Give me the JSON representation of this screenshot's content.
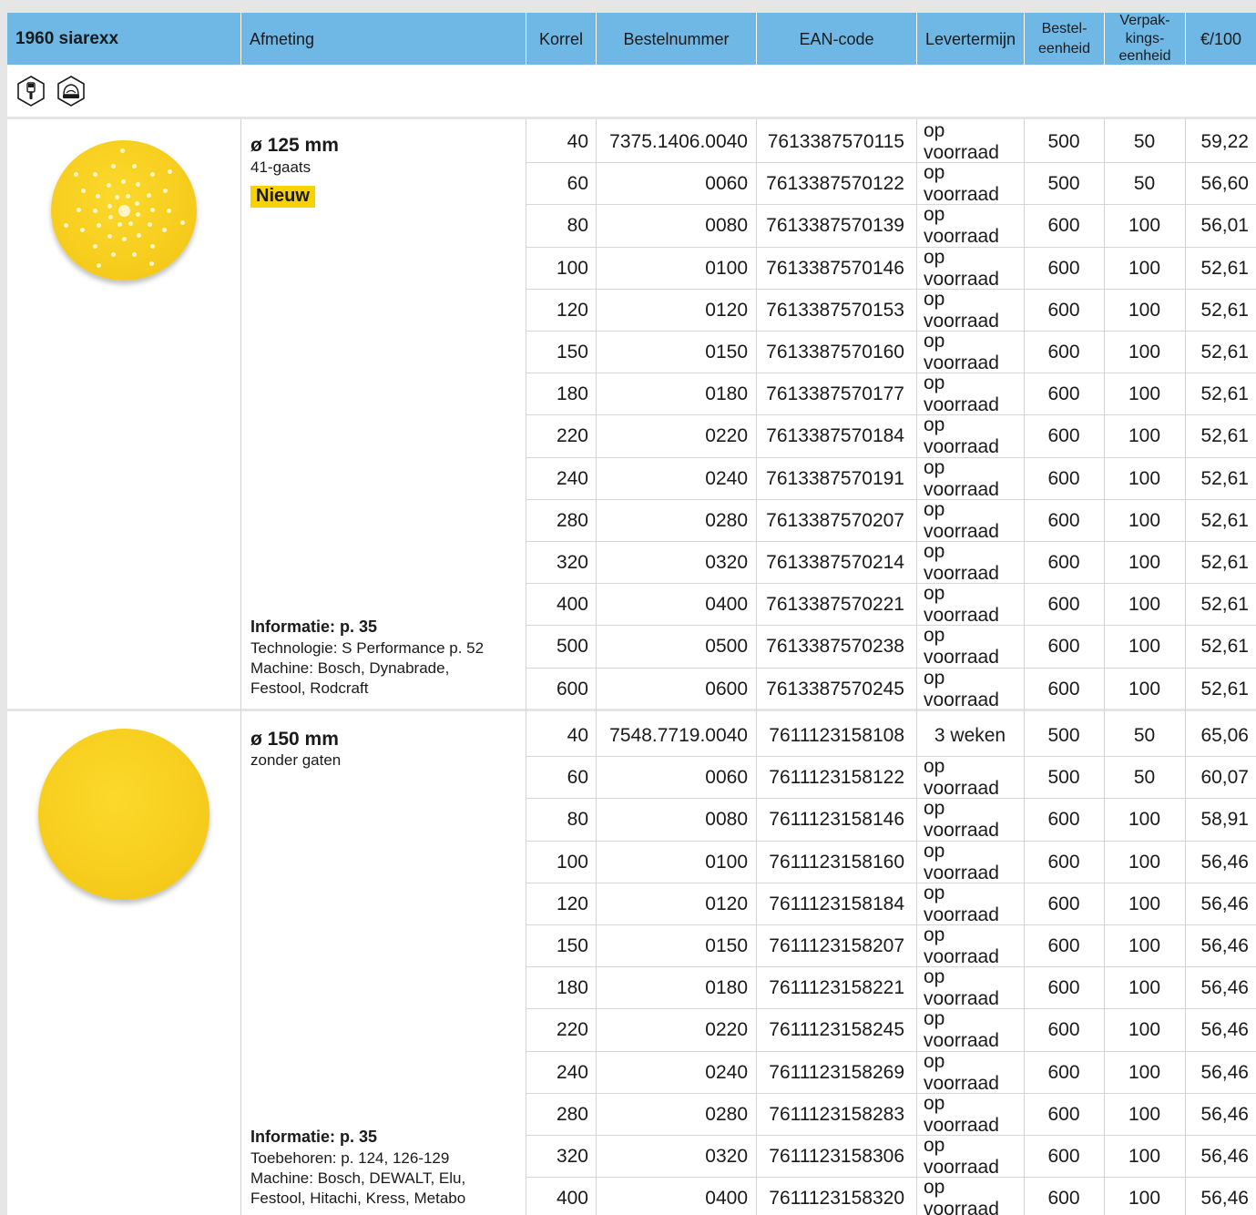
{
  "header": {
    "product": "1960 siarexx",
    "afmeting": "Afmeting",
    "korrel": "Korrel",
    "bestelnummer": "Bestelnummer",
    "ean": "EAN-code",
    "levertermijn": "Levertermijn",
    "besteleenheid_1": "Bestel-",
    "besteleenheid_2": "eenheid",
    "verpak_1": "Verpak-",
    "verpak_2": "kings-",
    "verpak_3": "eenheid",
    "price": "€/100"
  },
  "icons": [
    "brush-hex-icon",
    "sanding-machine-hex-icon"
  ],
  "sections": [
    {
      "size": "ø 125 mm",
      "subtitle": "41-gaats",
      "badge": "Nieuw",
      "info_title": "Informatie: p. 35",
      "notes": [
        "Technologie: S Performance p. 52",
        "Machine: Bosch, Dynabrade,",
        "Festool, Rodcraft"
      ],
      "rows": [
        {
          "korrel": "40",
          "bestel": "7375.1406.0040",
          "ean": "7613387570115",
          "lever": "op voorraad",
          "be": "500",
          "ve": "50",
          "prijs": "59,22"
        },
        {
          "korrel": "60",
          "bestel": "0060",
          "ean": "7613387570122",
          "lever": "op voorraad",
          "be": "500",
          "ve": "50",
          "prijs": "56,60"
        },
        {
          "korrel": "80",
          "bestel": "0080",
          "ean": "7613387570139",
          "lever": "op voorraad",
          "be": "600",
          "ve": "100",
          "prijs": "56,01"
        },
        {
          "korrel": "100",
          "bestel": "0100",
          "ean": "7613387570146",
          "lever": "op voorraad",
          "be": "600",
          "ve": "100",
          "prijs": "52,61"
        },
        {
          "korrel": "120",
          "bestel": "0120",
          "ean": "7613387570153",
          "lever": "op voorraad",
          "be": "600",
          "ve": "100",
          "prijs": "52,61"
        },
        {
          "korrel": "150",
          "bestel": "0150",
          "ean": "7613387570160",
          "lever": "op voorraad",
          "be": "600",
          "ve": "100",
          "prijs": "52,61"
        },
        {
          "korrel": "180",
          "bestel": "0180",
          "ean": "7613387570177",
          "lever": "op voorraad",
          "be": "600",
          "ve": "100",
          "prijs": "52,61"
        },
        {
          "korrel": "220",
          "bestel": "0220",
          "ean": "7613387570184",
          "lever": "op voorraad",
          "be": "600",
          "ve": "100",
          "prijs": "52,61"
        },
        {
          "korrel": "240",
          "bestel": "0240",
          "ean": "7613387570191",
          "lever": "op voorraad",
          "be": "600",
          "ve": "100",
          "prijs": "52,61"
        },
        {
          "korrel": "280",
          "bestel": "0280",
          "ean": "7613387570207",
          "lever": "op voorraad",
          "be": "600",
          "ve": "100",
          "prijs": "52,61"
        },
        {
          "korrel": "320",
          "bestel": "0320",
          "ean": "7613387570214",
          "lever": "op voorraad",
          "be": "600",
          "ve": "100",
          "prijs": "52,61"
        },
        {
          "korrel": "400",
          "bestel": "0400",
          "ean": "7613387570221",
          "lever": "op voorraad",
          "be": "600",
          "ve": "100",
          "prijs": "52,61"
        },
        {
          "korrel": "500",
          "bestel": "0500",
          "ean": "7613387570238",
          "lever": "op voorraad",
          "be": "600",
          "ve": "100",
          "prijs": "52,61"
        },
        {
          "korrel": "600",
          "bestel": "0600",
          "ean": "7613387570245",
          "lever": "op voorraad",
          "be": "600",
          "ve": "100",
          "prijs": "52,61"
        }
      ]
    },
    {
      "size": "ø 150 mm",
      "subtitle": "zonder gaten",
      "badge": "",
      "info_title": "Informatie: p. 35",
      "notes": [
        "Toebehoren: p. 124, 126-129",
        "Machine: Bosch, DEWALT, Elu,",
        "Festool, Hitachi, Kress, Metabo"
      ],
      "rows": [
        {
          "korrel": "40",
          "bestel": "7548.7719.0040",
          "ean": "7611123158108",
          "lever": "3 weken",
          "be": "500",
          "ve": "50",
          "prijs": "65,06"
        },
        {
          "korrel": "60",
          "bestel": "0060",
          "ean": "7611123158122",
          "lever": "op voorraad",
          "be": "500",
          "ve": "50",
          "prijs": "60,07"
        },
        {
          "korrel": "80",
          "bestel": "0080",
          "ean": "7611123158146",
          "lever": "op voorraad",
          "be": "600",
          "ve": "100",
          "prijs": "58,91"
        },
        {
          "korrel": "100",
          "bestel": "0100",
          "ean": "7611123158160",
          "lever": "op voorraad",
          "be": "600",
          "ve": "100",
          "prijs": "56,46"
        },
        {
          "korrel": "120",
          "bestel": "0120",
          "ean": "7611123158184",
          "lever": "op voorraad",
          "be": "600",
          "ve": "100",
          "prijs": "56,46"
        },
        {
          "korrel": "150",
          "bestel": "0150",
          "ean": "7611123158207",
          "lever": "op voorraad",
          "be": "600",
          "ve": "100",
          "prijs": "56,46"
        },
        {
          "korrel": "180",
          "bestel": "0180",
          "ean": "7611123158221",
          "lever": "op voorraad",
          "be": "600",
          "ve": "100",
          "prijs": "56,46"
        },
        {
          "korrel": "220",
          "bestel": "0220",
          "ean": "7611123158245",
          "lever": "op voorraad",
          "be": "600",
          "ve": "100",
          "prijs": "56,46"
        },
        {
          "korrel": "240",
          "bestel": "0240",
          "ean": "7611123158269",
          "lever": "op voorraad",
          "be": "600",
          "ve": "100",
          "prijs": "56,46"
        },
        {
          "korrel": "280",
          "bestel": "0280",
          "ean": "7611123158283",
          "lever": "op voorraad",
          "be": "600",
          "ve": "100",
          "prijs": "56,46"
        },
        {
          "korrel": "320",
          "bestel": "0320",
          "ean": "7611123158306",
          "lever": "op voorraad",
          "be": "600",
          "ve": "100",
          "prijs": "56,46"
        },
        {
          "korrel": "400",
          "bestel": "0400",
          "ean": "7611123158320",
          "lever": "op voorraad",
          "be": "600",
          "ve": "100",
          "prijs": "56,46"
        }
      ]
    }
  ],
  "colors": {
    "header_bg": "#6fb8e6",
    "disc_yellow": "#f7cd1d",
    "badge_yellow": "#f6d200",
    "page_bg": "#e6e6e6"
  }
}
